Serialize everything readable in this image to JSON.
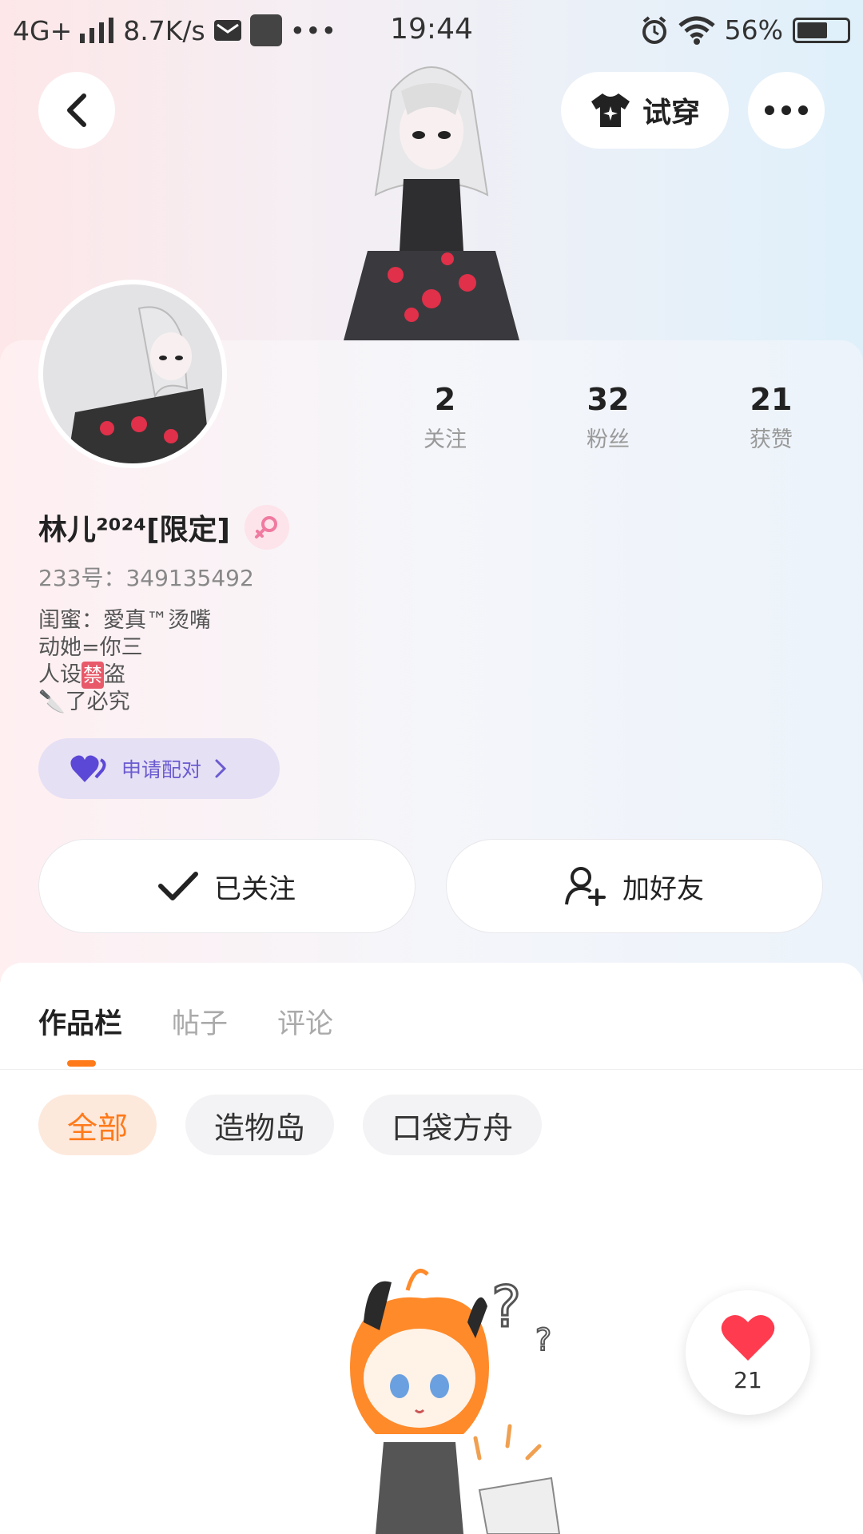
{
  "status_bar": {
    "network": "4G+",
    "speed": "8.7K/s",
    "time": "19:44",
    "battery": "56%"
  },
  "header": {
    "try_on_label": "试穿"
  },
  "profile": {
    "stats": [
      {
        "value": "2",
        "label": "关注"
      },
      {
        "value": "32",
        "label": "粉丝"
      },
      {
        "value": "21",
        "label": "获赞"
      }
    ],
    "name": "林儿²⁰²⁴[限定]",
    "uid": "233号：349135492",
    "bio": [
      "闺蜜：愛真™烫嘴",
      "动她=你三",
      "人设",
      "盗",
      "了必究"
    ],
    "bio_ban": "禁",
    "pair_label": "申请配对"
  },
  "actions": {
    "follow_label": "已关注",
    "add_friend_label": "加好友"
  },
  "tabs": [
    {
      "label": "作品栏"
    },
    {
      "label": "帖子"
    },
    {
      "label": "评论"
    }
  ],
  "filters": [
    {
      "label": "全部"
    },
    {
      "label": "造物岛"
    },
    {
      "label": "口袋方舟"
    }
  ],
  "like_count": "21",
  "colors": {
    "accent": "#ff7a1a",
    "pair": "#6a5bd0",
    "heart": "#ff3b4f"
  }
}
